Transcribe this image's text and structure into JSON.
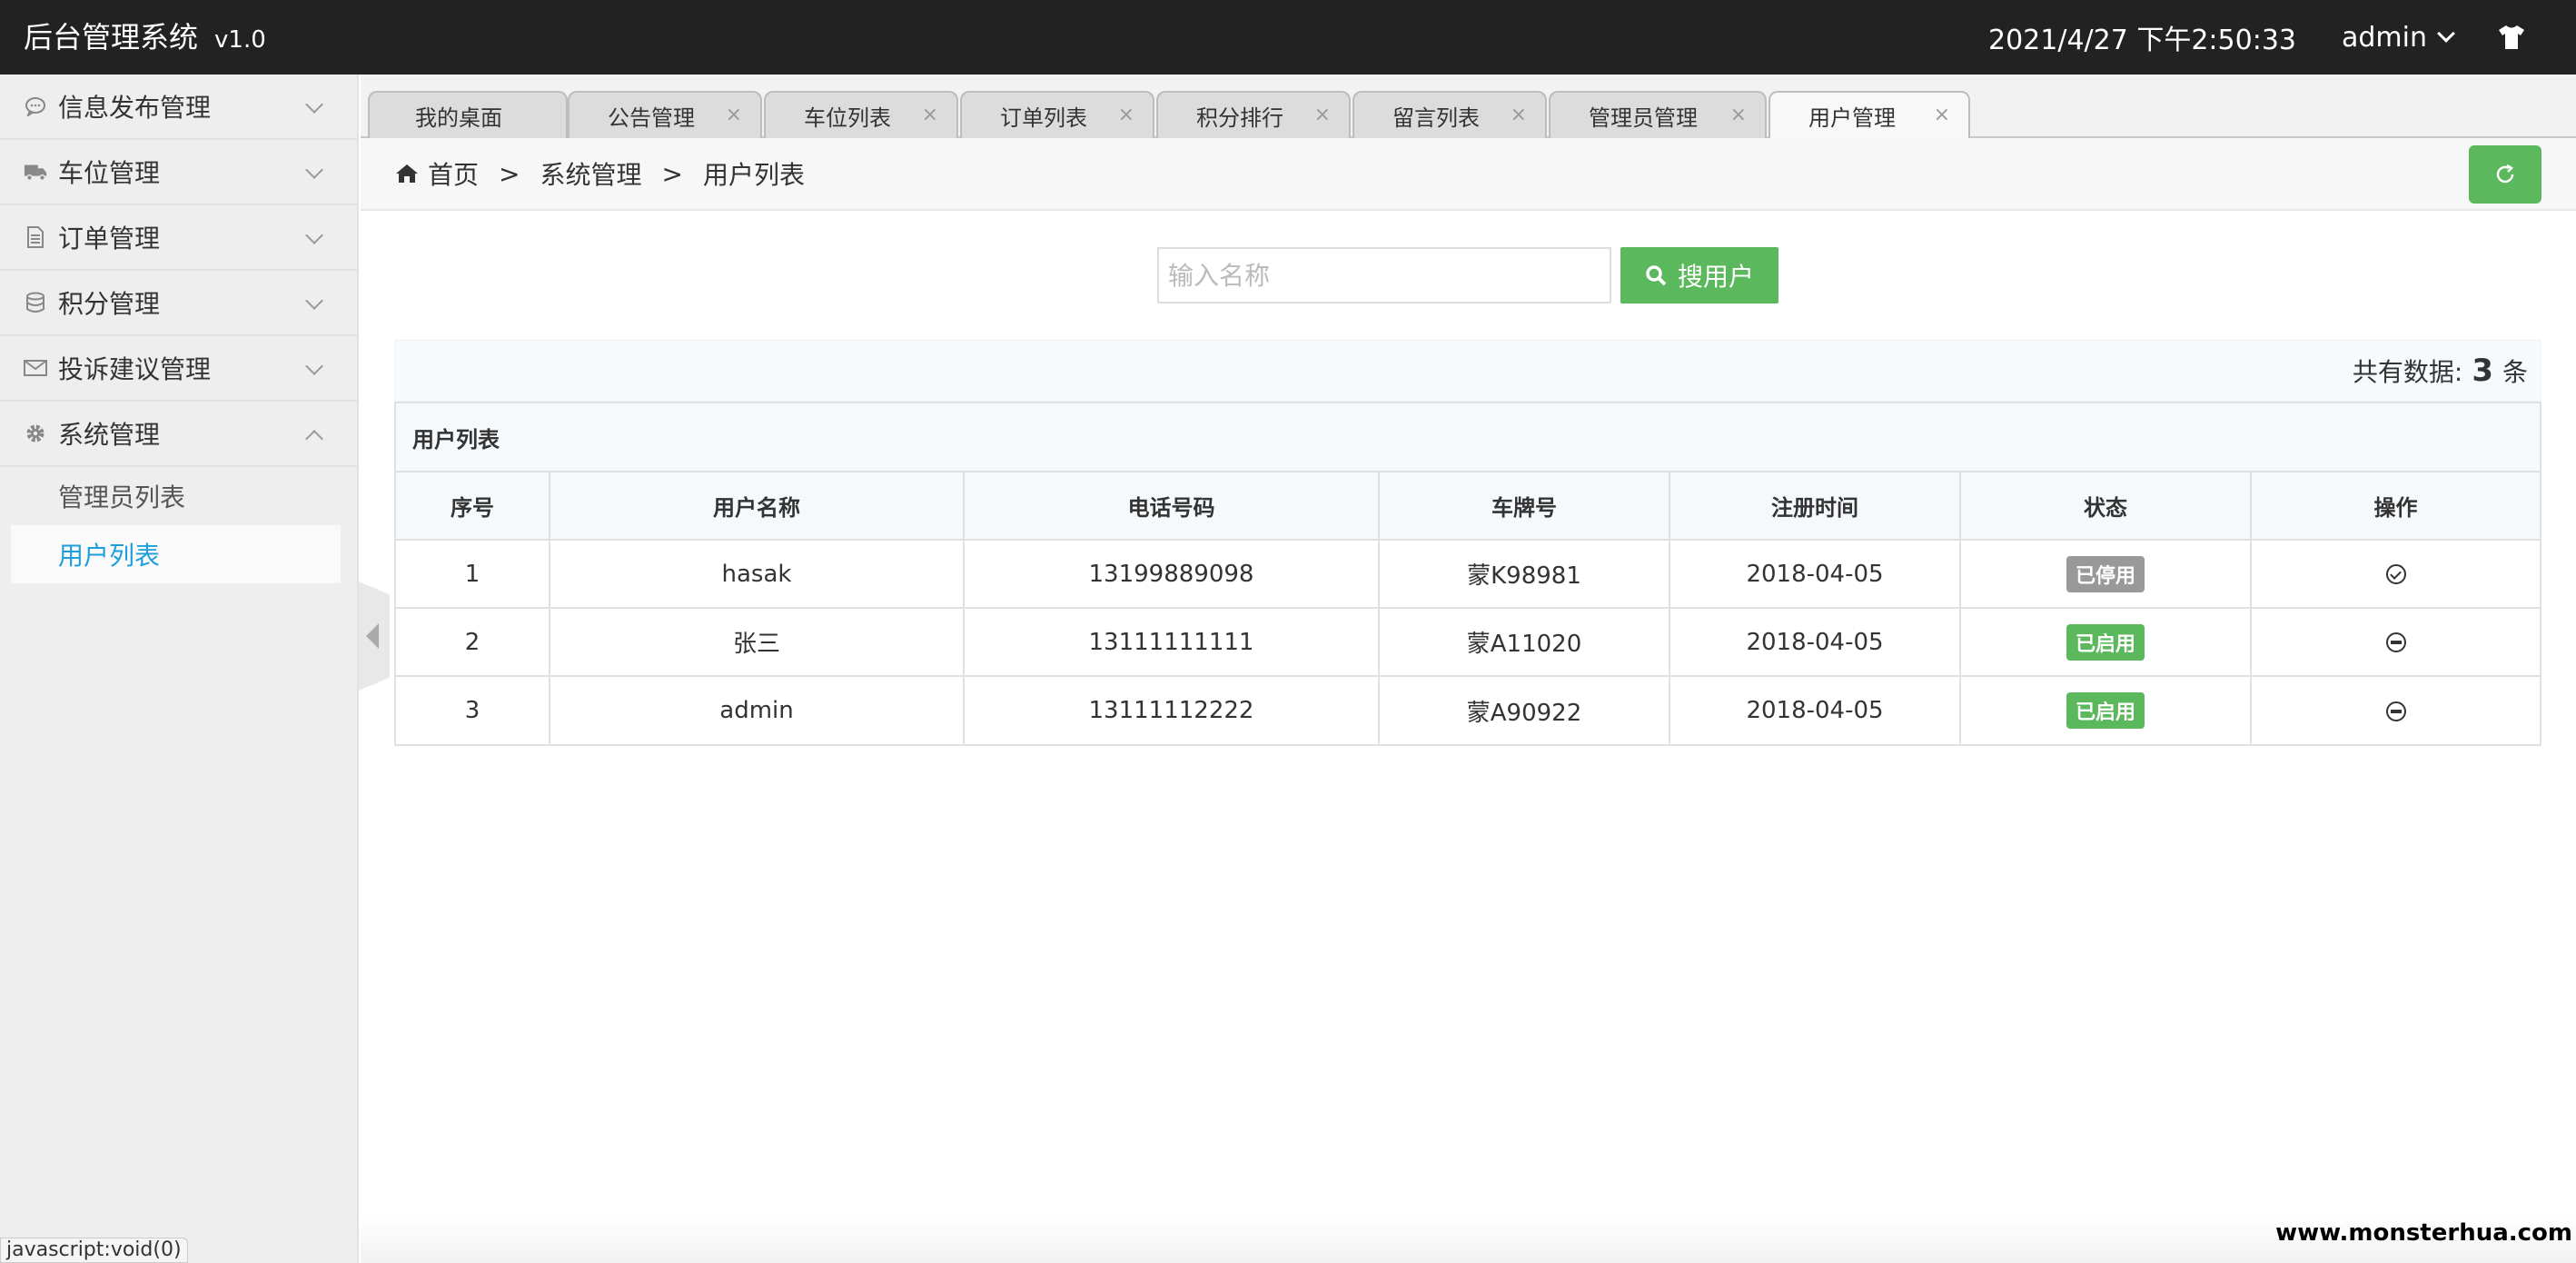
{
  "header": {
    "title": "后台管理系统",
    "version": "v1.0",
    "datetime": "2021/4/27 下午2:50:33",
    "user": "admin",
    "theme_icon": "tshirt-icon"
  },
  "sidebar": {
    "items": [
      {
        "label": "信息发布管理",
        "icon": "comment-icon"
      },
      {
        "label": "车位管理",
        "icon": "truck-icon"
      },
      {
        "label": "订单管理",
        "icon": "document-icon"
      },
      {
        "label": "积分管理",
        "icon": "database-icon"
      },
      {
        "label": "投诉建议管理",
        "icon": "envelope-icon"
      },
      {
        "label": "系统管理",
        "icon": "gear-icon",
        "expanded": true
      }
    ],
    "subitems": [
      {
        "label": "管理员列表",
        "active": false
      },
      {
        "label": "用户列表",
        "active": true
      }
    ]
  },
  "tabs": [
    {
      "label": "我的桌面",
      "closable": false
    },
    {
      "label": "公告管理",
      "closable": true
    },
    {
      "label": "车位列表",
      "closable": true
    },
    {
      "label": "订单列表",
      "closable": true
    },
    {
      "label": "积分排行",
      "closable": true
    },
    {
      "label": "留言列表",
      "closable": true
    },
    {
      "label": "管理员管理",
      "closable": true
    },
    {
      "label": "用户管理",
      "closable": true,
      "active": true
    }
  ],
  "tab_close": "×",
  "breadcrumb": {
    "home": "首页",
    "sep": ">",
    "level1": "系统管理",
    "level2": "用户列表"
  },
  "search": {
    "placeholder": "输入名称",
    "value": "",
    "button_label": "搜用户"
  },
  "count": {
    "prefix": "共有数据:",
    "value": "3",
    "suffix": "条"
  },
  "table": {
    "caption": "用户列表",
    "columns": [
      "序号",
      "用户名称",
      "电话号码",
      "车牌号",
      "注册时间",
      "状态",
      "操作"
    ],
    "rows": [
      {
        "id": "1",
        "name": "hasak",
        "phone": "13199889098",
        "plate": "蒙K98981",
        "date": "2018-04-05",
        "status": "已停用",
        "status_type": "off",
        "action_icon": "check-circle-icon"
      },
      {
        "id": "2",
        "name": "张三",
        "phone": "13111111111",
        "plate": "蒙A11020",
        "date": "2018-04-05",
        "status": "已启用",
        "status_type": "on",
        "action_icon": "minus-circle-icon"
      },
      {
        "id": "3",
        "name": "admin",
        "phone": "13111112222",
        "plate": "蒙A90922",
        "date": "2018-04-05",
        "status": "已启用",
        "status_type": "on",
        "action_icon": "minus-circle-icon"
      }
    ]
  },
  "statusbar": "javascript:void(0)",
  "watermark": "www.monsterhua.com",
  "colors": {
    "header_bg": "#222222",
    "accent_green": "#5cb85c",
    "active_link": "#1e9fdb",
    "badge_off": "#999999"
  }
}
